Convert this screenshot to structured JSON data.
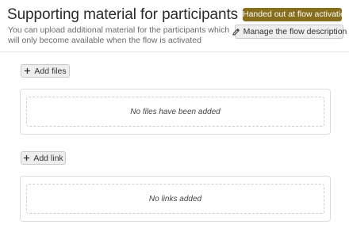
{
  "header": {
    "title": "Supporting material for participants",
    "description": "You can upload additional material for the participants which will only become available when the flow is activated",
    "status_badge": "Handed out at flow activation",
    "manage_button_label": "Manage the flow description",
    "manage_button_icon": "pencil-icon"
  },
  "files": {
    "add_button_label": "Add files",
    "add_button_icon": "plus-icon",
    "empty_text": "No files have been added"
  },
  "links": {
    "add_button_label": "Add link",
    "add_button_icon": "plus-icon",
    "empty_text": "No links added"
  },
  "colors": {
    "badge_bg": "#876e1c",
    "button_bg": "#eeeeee",
    "border": "#dcdcdc"
  }
}
